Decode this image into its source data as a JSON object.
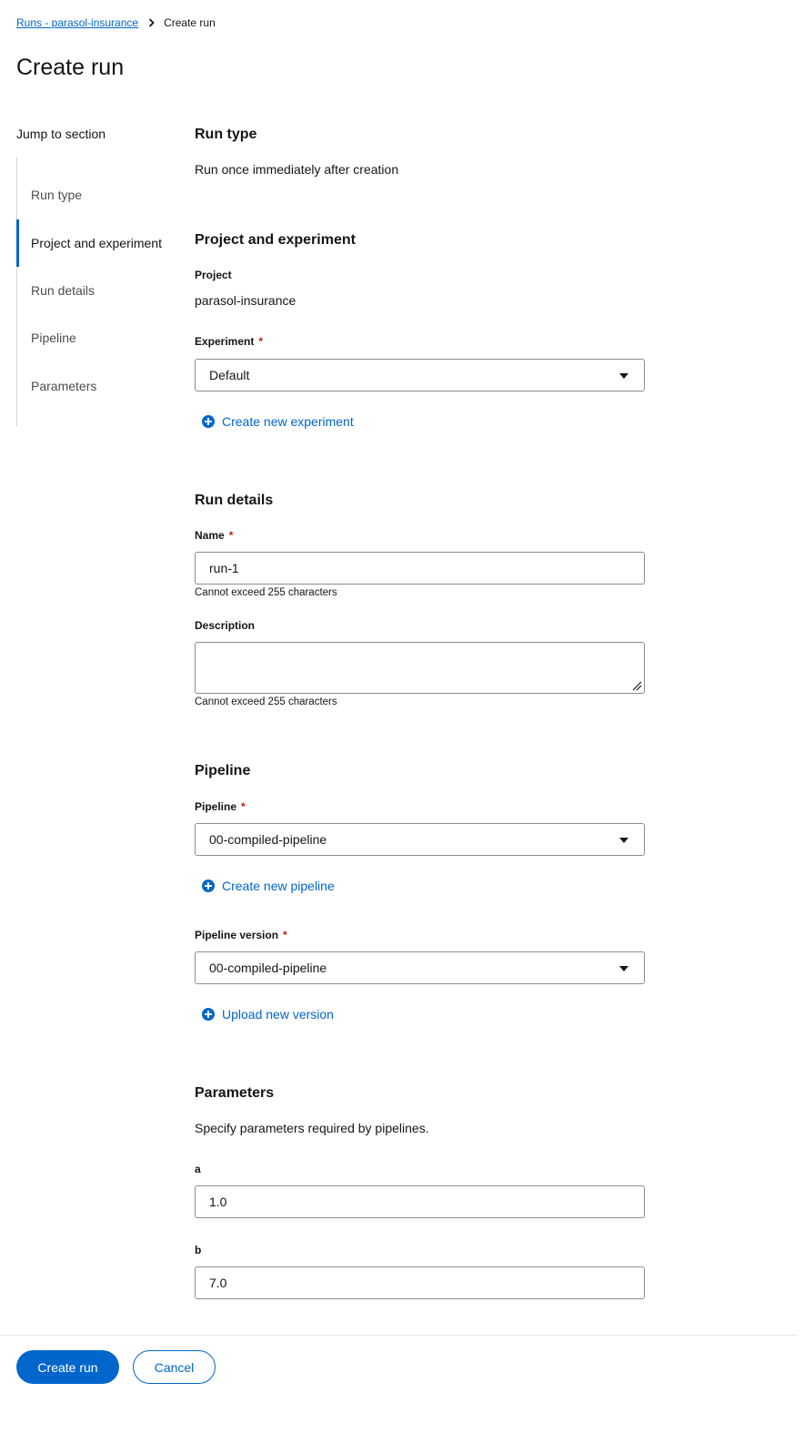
{
  "breadcrumb": {
    "parent": "Runs - parasol-insurance",
    "current": "Create run"
  },
  "page_title": "Create run",
  "jump": {
    "title": "Jump to section",
    "items": [
      {
        "label": "Run type",
        "active": false
      },
      {
        "label": "Project and experiment",
        "active": true
      },
      {
        "label": "Run details",
        "active": false
      },
      {
        "label": "Pipeline",
        "active": false
      },
      {
        "label": "Parameters",
        "active": false
      }
    ]
  },
  "run_type": {
    "heading": "Run type",
    "value": "Run once immediately after creation"
  },
  "project_experiment": {
    "heading": "Project and experiment",
    "project_label": "Project",
    "project_value": "parasol-insurance",
    "experiment_label": "Experiment",
    "experiment_required": "*",
    "experiment_value": "Default",
    "create_experiment": "Create new experiment"
  },
  "run_details": {
    "heading": "Run details",
    "name_label": "Name",
    "name_required": "*",
    "name_value": "run-1",
    "name_helper": "Cannot exceed 255 characters",
    "description_label": "Description",
    "description_helper": "Cannot exceed 255 characters"
  },
  "pipeline": {
    "heading": "Pipeline",
    "pipeline_label": "Pipeline",
    "pipeline_required": "*",
    "pipeline_value": "00-compiled-pipeline",
    "create_pipeline": "Create new pipeline",
    "version_label": "Pipeline version",
    "version_required": "*",
    "version_value": "00-compiled-pipeline",
    "upload_version": "Upload new version"
  },
  "parameters": {
    "heading": "Parameters",
    "description": "Specify parameters required by pipelines.",
    "a_label": "a",
    "a_value": "1.0",
    "b_label": "b",
    "b_value": "7.0"
  },
  "footer": {
    "create_label": "Create run",
    "cancel_label": "Cancel"
  },
  "colors": {
    "accent": "#0066cc",
    "required": "#c9190b",
    "border": "#8a8d90"
  }
}
